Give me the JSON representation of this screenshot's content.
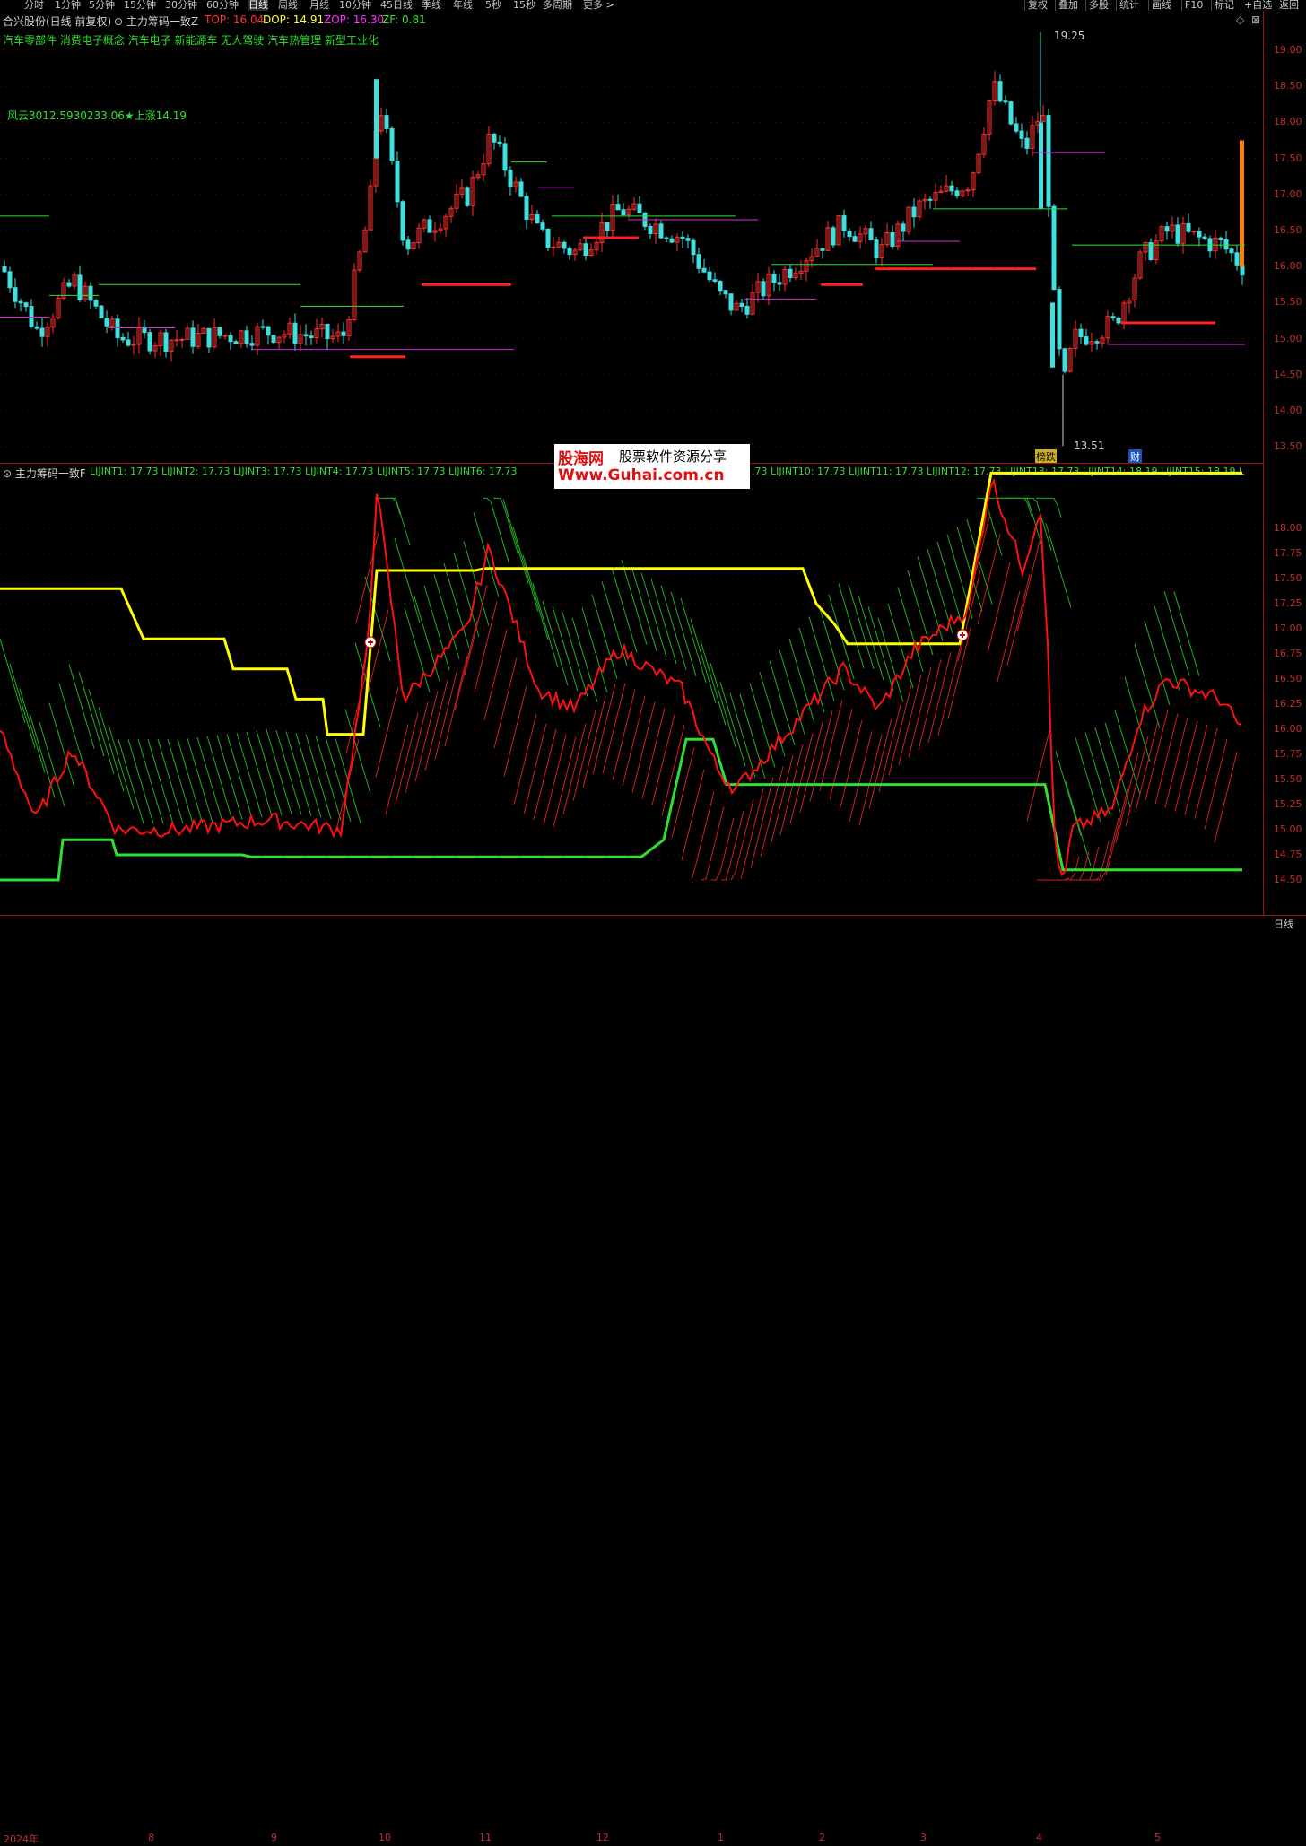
{
  "timeframes": [
    "分时",
    "1分钟",
    "5分钟",
    "15分钟",
    "30分钟",
    "60分钟",
    "日线",
    "周线",
    "月线",
    "10分钟",
    "45日线",
    "季线",
    "年线",
    "5秒",
    "15秒",
    "多周期",
    "更多 >"
  ],
  "active_timeframe": "日线",
  "right_tools": [
    "复权",
    "叠加",
    "多股",
    "统计",
    "画线",
    "F10",
    "标记",
    "+自选",
    "返回"
  ],
  "main_header": {
    "stock": "合兴股份(日线 前复权)",
    "indicator": "主力筹码一致Z",
    "top": "TOP: 16.04",
    "dop": "DOP: 14.91",
    "zop": "ZOP: 16.30",
    "zf": "ZF: 0.81"
  },
  "concepts": "汽车零部件 消费电子概念 汽车电子 新能源车 无人驾驶 汽车热管理 新型工业化",
  "fengyun": "风云3012.5930233.06★上涨14.19",
  "high_label": "19.25",
  "low_label": "13.51",
  "badge1": "榜跌",
  "badge2": "财",
  "price_axis": [
    "19.00",
    "18.50",
    "18.00",
    "17.50",
    "17.00",
    "16.50",
    "16.00",
    "15.50",
    "15.00",
    "14.50",
    "14.00",
    "13.50"
  ],
  "sub_header": {
    "name": "主力筹码一致F",
    "values": "LIJINT1: 17.73  LIJINT2: 17.73  LIJINT3: 17.73  LIJINT4: 17.73  LIJINT5: 17.73  LIJINT6: 17.73",
    "values2": ".73  LIJINT10: 17.73  LIJINT11: 17.73  LIJINT12: 17.73  LIJINT13: 17.73  LIJINT14: 18.19  LIJINT15: 18.19  L"
  },
  "sub_axis": [
    "18.00",
    "17.75",
    "17.50",
    "17.25",
    "17.00",
    "16.75",
    "16.50",
    "16.25",
    "16.00",
    "15.75",
    "15.50",
    "15.25",
    "15.00",
    "14.75",
    "14.50"
  ],
  "date_axis": [
    "2024年",
    "8",
    "9",
    "10",
    "11",
    "12",
    "1",
    "2",
    "3",
    "4",
    "5"
  ],
  "period_label": "日线",
  "watermark": {
    "line1": "股海网",
    "line1b": "股票软件资源分享",
    "line2": "Www.Guhai.com.cn"
  },
  "colors": {
    "up": "#ff3030",
    "down": "#40e0e0",
    "green": "#30e030",
    "yellow": "#ffff00",
    "magenta": "#d030d0"
  }
}
